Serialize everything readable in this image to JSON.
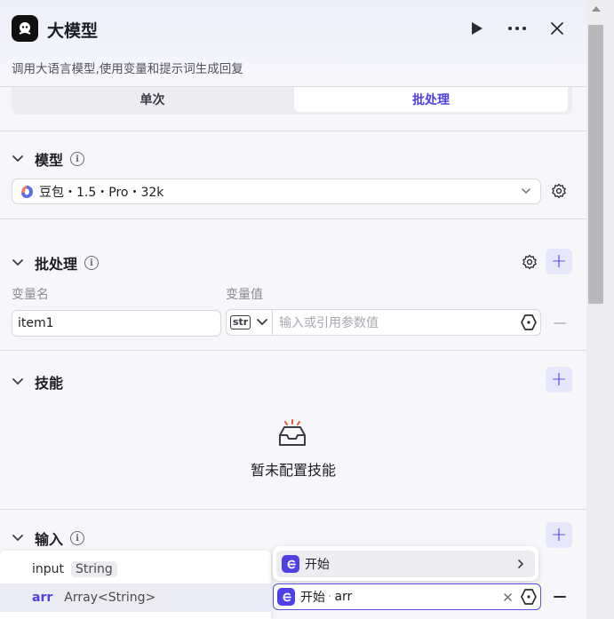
{
  "header": {
    "title": "大模型",
    "description": "调用大语言模型,使用变量和提示词生成回复"
  },
  "mode_tabs": [
    {
      "label": "单次"
    },
    {
      "label": "批处理"
    }
  ],
  "model_section": {
    "title": "模型",
    "selected_model": "豆包・1.5・Pro・32k"
  },
  "batch_section": {
    "title": "批处理",
    "col_name": "变量名",
    "col_value": "变量值",
    "rows": [
      {
        "name": "item1",
        "type": "str",
        "value_placeholder": "输入或引用参数值"
      }
    ]
  },
  "skills_section": {
    "title": "技能",
    "empty_text": "暂未配置技能"
  },
  "input_section": {
    "title": "输入",
    "variables": [
      {
        "name": "input",
        "type": "String"
      },
      {
        "name": "arr",
        "type": "Array<String>"
      }
    ],
    "node_option": "开始",
    "reference": {
      "node": "开始",
      "var": "arr"
    }
  },
  "colors": {
    "accent": "#4e40e5",
    "accent_soft": "#e7e7fb",
    "panel_bg": "#f7f7fa",
    "danger": "#e05a3a"
  },
  "icons": [
    "node-avatar-icon",
    "play-icon",
    "more-icon",
    "close-icon",
    "info-icon",
    "settings-icon",
    "add-icon",
    "chevron-down-icon",
    "variable-icon",
    "empty-tray-icon",
    "clear-icon",
    "chevron-right-icon"
  ]
}
